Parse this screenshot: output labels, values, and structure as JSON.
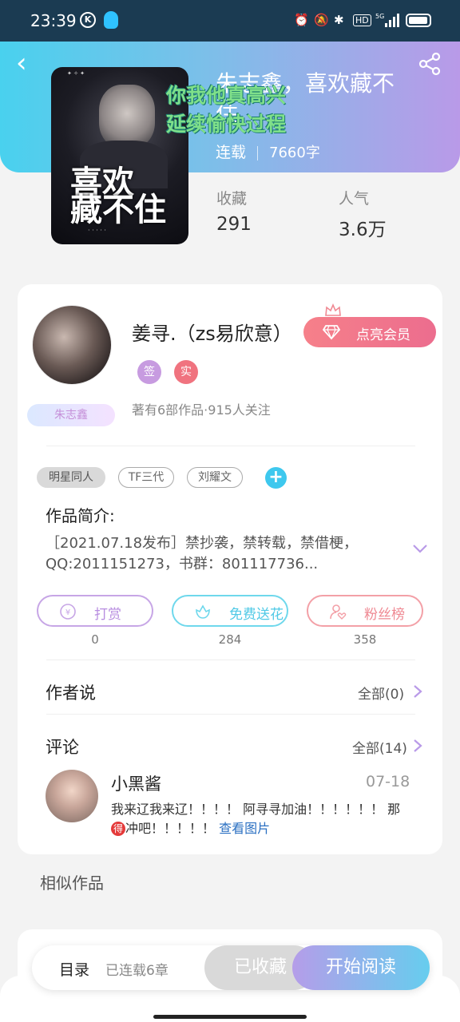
{
  "status_bar": {
    "time": "23:39",
    "k_icon": "K",
    "right_icons": [
      "alarm-icon",
      "mute-icon",
      "bluetooth-icon",
      "hd-icon",
      "5g-signal-icon",
      "battery-icon"
    ]
  },
  "book": {
    "title": "朱志鑫，喜欢藏不住",
    "status": "连载",
    "words": "7660字",
    "collect_label": "收藏",
    "collect_value": "291",
    "popularity_label": "人气",
    "popularity_value": "3.6万"
  },
  "cover": {
    "title_line1": "喜欢",
    "title_line2": "藏不住"
  },
  "overlay_text": {
    "line1": "你我他真高兴",
    "line2": "延续愉快过程"
  },
  "author": {
    "name": "姜寻.（zs易欣意）",
    "fan_badge": "朱志鑫",
    "badge_sign": "签",
    "badge_real": "实",
    "works_info": "著有6部作品·915人关注",
    "vip_button": "点亮会员"
  },
  "tags": [
    "明星同人",
    "TF三代",
    "刘耀文"
  ],
  "intro": {
    "title": "作品简介:",
    "text": "［2021.07.18发布］禁抄袭，禁转载，禁借梗，QQ:2011151273，书群：801117736..."
  },
  "actions": [
    {
      "label": "打赏",
      "count": "0"
    },
    {
      "label": "免费送花",
      "count": "284"
    },
    {
      "label": "粉丝榜",
      "count": "358"
    }
  ],
  "author_says": {
    "title": "作者说",
    "link": "全部(0)"
  },
  "comments": {
    "title": "评论",
    "link": "全部(14)",
    "item": {
      "name": "小黑酱",
      "date": "07-18",
      "text_part1": "我来辽我来辽！！！！ 阿寻寻加油！！！！！！ 那",
      "mark": "得",
      "text_part2": "冲吧！！！！！ ",
      "link": "查看图片"
    }
  },
  "similar": {
    "title": "相似作品"
  },
  "bottom_bar": {
    "toc": "目录",
    "chapters": "已连载6章",
    "favorited": "已收藏",
    "start_read": "开始阅读"
  },
  "colors": {
    "accent_cyan": "#49d1ee",
    "accent_purple": "#b99ae8",
    "vip_pink": "#ef7389"
  }
}
